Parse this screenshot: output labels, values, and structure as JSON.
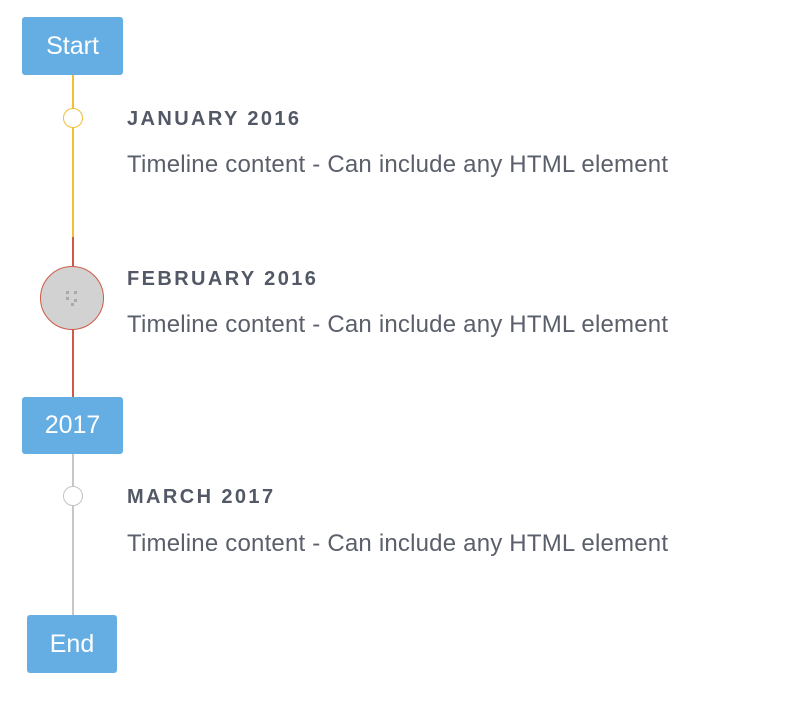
{
  "colors": {
    "tag_background": "#64aee4",
    "tag_text": "#ffffff",
    "line_first": "#f0be3b",
    "line_second": "#cf5a48",
    "line_third": "#c7c7c7",
    "big_dot_fill": "#d2d2d2",
    "date_text": "#535866",
    "body_text": "#5a5f6b"
  },
  "timeline": {
    "start_label": "Start",
    "divider_label": "2017",
    "end_label": "End",
    "items": [
      {
        "date": "JANUARY 2016",
        "content": "Timeline content - Can include any HTML element",
        "marker": "small-circle"
      },
      {
        "date": "FEBRUARY 2016",
        "content": "Timeline content - Can include any HTML element",
        "marker": "large-circle-with-icon",
        "icon": "dots-icon"
      },
      {
        "date": "MARCH 2017",
        "content": "Timeline content - Can include any HTML element",
        "marker": "small-circle"
      }
    ]
  }
}
